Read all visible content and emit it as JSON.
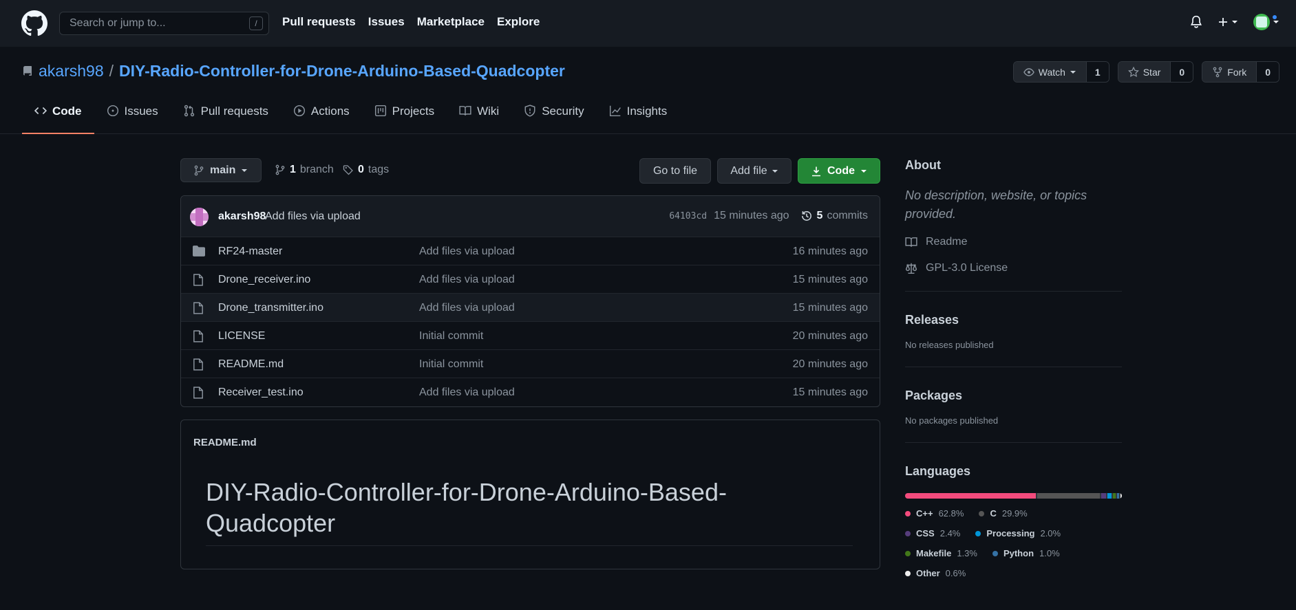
{
  "header": {
    "search_placeholder": "Search or jump to...",
    "search_shortcut": "/",
    "nav": [
      "Pull requests",
      "Issues",
      "Marketplace",
      "Explore"
    ]
  },
  "repo": {
    "owner": "akarsh98",
    "separator": "/",
    "name": "DIY-Radio-Controller-for-Drone-Arduino-Based-Quadcopter",
    "watch_label": "Watch",
    "watch_count": "1",
    "star_label": "Star",
    "star_count": "0",
    "fork_label": "Fork",
    "fork_count": "0"
  },
  "tabs": [
    {
      "label": "Code",
      "icon": "code-icon",
      "active": true
    },
    {
      "label": "Issues",
      "icon": "issue-opened-icon"
    },
    {
      "label": "Pull requests",
      "icon": "git-pull-request-icon"
    },
    {
      "label": "Actions",
      "icon": "play-icon"
    },
    {
      "label": "Projects",
      "icon": "project-icon"
    },
    {
      "label": "Wiki",
      "icon": "book-icon"
    },
    {
      "label": "Security",
      "icon": "shield-icon"
    },
    {
      "label": "Insights",
      "icon": "graph-icon"
    }
  ],
  "toolbar": {
    "branch": "main",
    "branch_count": "1",
    "branch_word": "branch",
    "tag_count": "0",
    "tag_word": "tags",
    "goto_file": "Go to file",
    "add_file": "Add file",
    "code": "Code"
  },
  "commit": {
    "author": "akarsh98",
    "message": "Add files via upload",
    "sha": "64103cd",
    "time": "15 minutes ago",
    "commit_count": "5",
    "commit_word": "commits"
  },
  "files": [
    {
      "type": "dir",
      "name": "RF24-master",
      "message": "Add files via upload",
      "age": "16 minutes ago"
    },
    {
      "type": "file",
      "name": "Drone_receiver.ino",
      "message": "Add files via upload",
      "age": "15 minutes ago"
    },
    {
      "type": "file",
      "name": "Drone_transmitter.ino",
      "message": "Add files via upload",
      "age": "15 minutes ago"
    },
    {
      "type": "file",
      "name": "LICENSE",
      "message": "Initial commit",
      "age": "20 minutes ago"
    },
    {
      "type": "file",
      "name": "README.md",
      "message": "Initial commit",
      "age": "20 minutes ago"
    },
    {
      "type": "file",
      "name": "Receiver_test.ino",
      "message": "Add files via upload",
      "age": "15 minutes ago"
    }
  ],
  "readme": {
    "label": "README.md",
    "heading_line1": "DIY-Radio-Controller-for-Drone-Arduino-Based-",
    "heading_line2": "Quadcopter"
  },
  "sidebar": {
    "about_title": "About",
    "about_desc": "No description, website, or topics provided.",
    "readme_link": "Readme",
    "license_link": "GPL-3.0 License",
    "releases_title": "Releases",
    "releases_text": "No releases published",
    "packages_title": "Packages",
    "packages_text": "No packages published",
    "languages_title": "Languages",
    "languages": [
      {
        "name": "C++",
        "pct": "62.8%",
        "value": 62.8,
        "color": "#f34b7d"
      },
      {
        "name": "C",
        "pct": "29.9%",
        "value": 29.9,
        "color": "#555555"
      },
      {
        "name": "CSS",
        "pct": "2.4%",
        "value": 2.4,
        "color": "#563d7c"
      },
      {
        "name": "Processing",
        "pct": "2.0%",
        "value": 2.0,
        "color": "#0096d8"
      },
      {
        "name": "Makefile",
        "pct": "1.3%",
        "value": 1.3,
        "color": "#427819"
      },
      {
        "name": "Python",
        "pct": "1.0%",
        "value": 1.0,
        "color": "#3572a5"
      },
      {
        "name": "Other",
        "pct": "0.6%",
        "value": 0.6,
        "color": "#ededed"
      }
    ]
  },
  "colors": {
    "bg": "#0d1117",
    "header_bg": "#161b22",
    "link": "#58a6ff",
    "green": "#238636",
    "tab_underline": "#f78166"
  }
}
